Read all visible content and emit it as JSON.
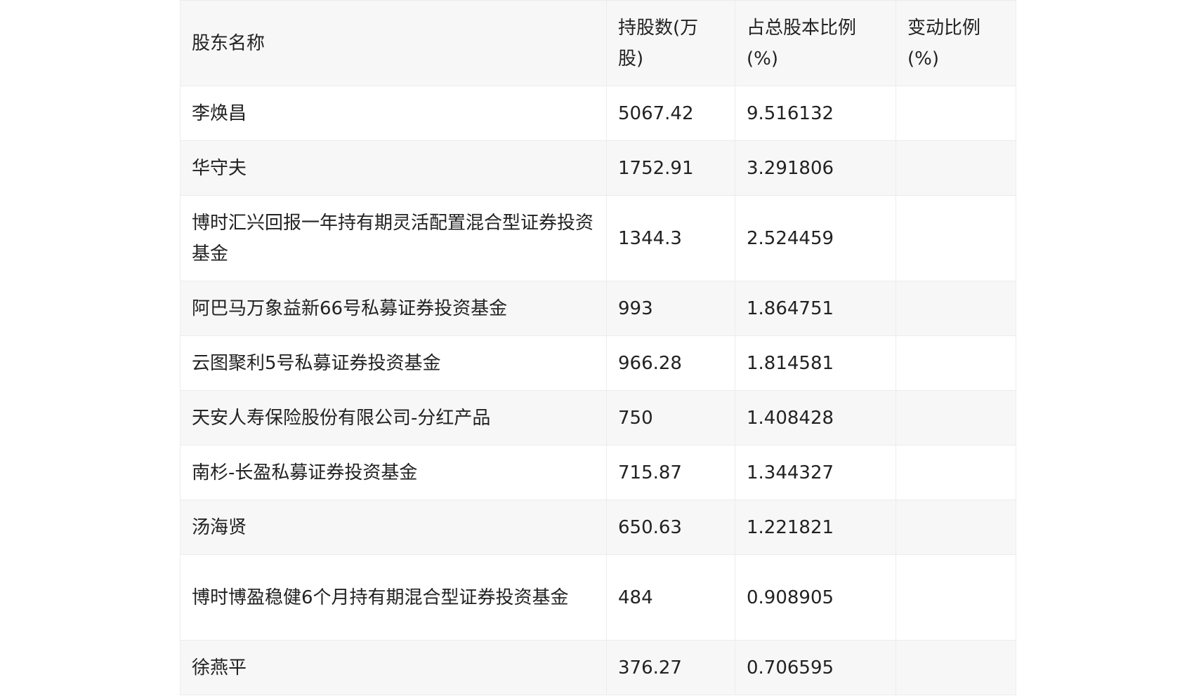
{
  "table": {
    "headers": [
      "股东名称",
      "持股数(万股)",
      "占总股本比例(%)",
      "变动比例(%)"
    ],
    "rows": [
      [
        "李焕昌",
        "5067.42",
        "9.516132",
        ""
      ],
      [
        "华守夫",
        "1752.91",
        "3.291806",
        ""
      ],
      [
        "博时汇兴回报一年持有期灵活配置混合型证券投资基金",
        "1344.3",
        "2.524459",
        ""
      ],
      [
        "阿巴马万象益新66号私募证券投资基金",
        "993",
        "1.864751",
        ""
      ],
      [
        "云图聚利5号私募证券投资基金",
        "966.28",
        "1.814581",
        ""
      ],
      [
        "天安人寿保险股份有限公司-分红产品",
        "750",
        "1.408428",
        ""
      ],
      [
        "南杉-长盈私募证券投资基金",
        "715.87",
        "1.344327",
        ""
      ],
      [
        "汤海贤",
        "650.63",
        "1.221821",
        ""
      ],
      [
        "博时博盈稳健6个月持有期混合型证券投资基金",
        "484",
        "0.908905",
        ""
      ],
      [
        "徐燕平",
        "376.27",
        "0.706595",
        ""
      ]
    ]
  }
}
